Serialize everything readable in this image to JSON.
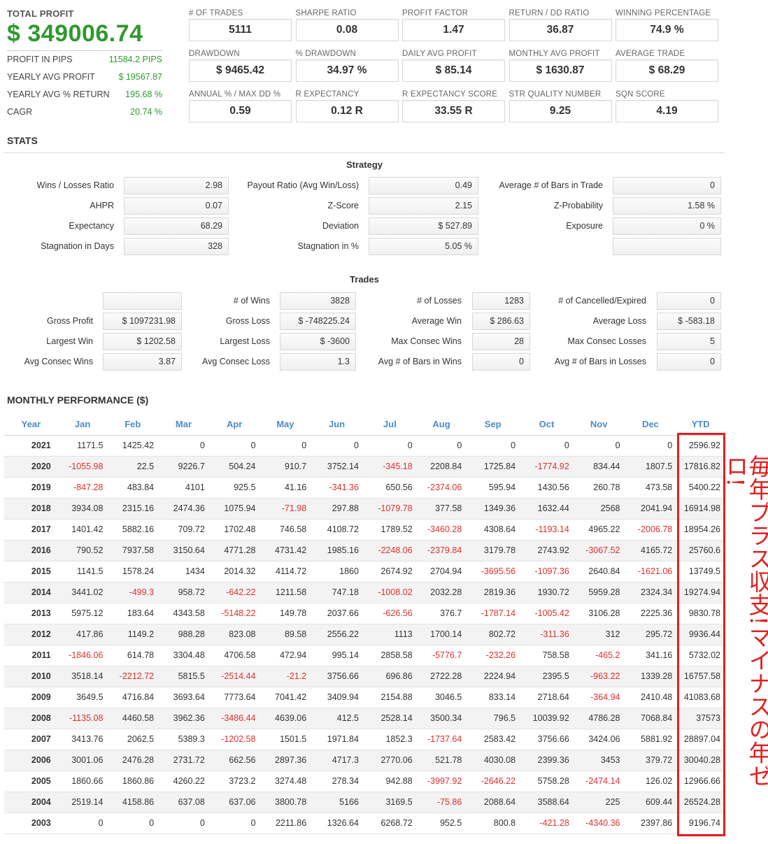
{
  "summary": {
    "total_label": "TOTAL PROFIT",
    "total_value": "$ 349006.74",
    "rows": [
      {
        "label": "PROFIT IN PIPS",
        "value": "11584.2 PIPS"
      },
      {
        "label": "YEARLY AVG PROFIT",
        "value": "$ 19567.87"
      },
      {
        "label": "YEARLY AVG % RETURN",
        "value": "195.68 %"
      },
      {
        "label": "CAGR",
        "value": "20.74 %"
      }
    ]
  },
  "metrics": [
    {
      "label": "# OF TRADES",
      "value": "5111"
    },
    {
      "label": "SHARPE RATIO",
      "value": "0.08"
    },
    {
      "label": "PROFIT FACTOR",
      "value": "1.47"
    },
    {
      "label": "RETURN / DD RATIO",
      "value": "36.87"
    },
    {
      "label": "WINNING PERCENTAGE",
      "value": "74.9 %"
    },
    {
      "label": "DRAWDOWN",
      "value": "$ 9465.42"
    },
    {
      "label": "% DRAWDOWN",
      "value": "34.97 %"
    },
    {
      "label": "DAILY AVG PROFIT",
      "value": "$ 85.14"
    },
    {
      "label": "MONTHLY AVG PROFIT",
      "value": "$ 1630.87"
    },
    {
      "label": "AVERAGE TRADE",
      "value": "$ 68.29"
    },
    {
      "label": "ANNUAL % / MAX DD %",
      "value": "0.59"
    },
    {
      "label": "R EXPECTANCY",
      "value": "0.12 R"
    },
    {
      "label": "R EXPECTANCY SCORE",
      "value": "33.55 R"
    },
    {
      "label": "STR QUALITY NUMBER",
      "value": "9.25"
    },
    {
      "label": "SQN SCORE",
      "value": "4.19"
    }
  ],
  "stats_title": "STATS",
  "strategy": {
    "title": "Strategy",
    "rows": [
      [
        {
          "label": "Wins / Losses Ratio",
          "value": "2.98"
        },
        {
          "label": "Payout Ratio (Avg Win/Loss)",
          "value": "0.49"
        },
        {
          "label": "Average # of Bars in Trade",
          "value": "0"
        }
      ],
      [
        {
          "label": "AHPR",
          "value": "0.07"
        },
        {
          "label": "Z-Score",
          "value": "2.15"
        },
        {
          "label": "Z-Probability",
          "value": "1.58 %"
        }
      ],
      [
        {
          "label": "Expectancy",
          "value": "68.29"
        },
        {
          "label": "Deviation",
          "value": "$ 527.89"
        },
        {
          "label": "Exposure",
          "value": "0 %"
        }
      ],
      [
        {
          "label": "Stagnation in Days",
          "value": "328"
        },
        {
          "label": "Stagnation in %",
          "value": "5.05 %"
        },
        {
          "label": "",
          "value": ""
        }
      ]
    ]
  },
  "trades": {
    "title": "Trades",
    "rows": [
      [
        {
          "label": "",
          "value": ""
        },
        {
          "label": "# of Wins",
          "value": "3828"
        },
        {
          "label": "# of Losses",
          "value": "1283"
        },
        {
          "label": "# of Cancelled/Expired",
          "value": "0"
        }
      ],
      [
        {
          "label": "Gross Profit",
          "value": "$ 1097231.98"
        },
        {
          "label": "Gross Loss",
          "value": "$ -748225.24"
        },
        {
          "label": "Average Win",
          "value": "$ 286.63"
        },
        {
          "label": "Average Loss",
          "value": "$ -583.18"
        }
      ],
      [
        {
          "label": "Largest Win",
          "value": "$ 1202.58"
        },
        {
          "label": "Largest Loss",
          "value": "$ -3600"
        },
        {
          "label": "Max Consec Wins",
          "value": "28"
        },
        {
          "label": "Max Consec Losses",
          "value": "5"
        }
      ],
      [
        {
          "label": "Avg Consec Wins",
          "value": "3.87"
        },
        {
          "label": "Avg Consec Loss",
          "value": "1.3"
        },
        {
          "label": "Avg # of Bars in Wins",
          "value": "0"
        },
        {
          "label": "Avg # of Bars in Losses",
          "value": "0"
        }
      ]
    ]
  },
  "monthly": {
    "title": "MONTHLY PERFORMANCE ($)",
    "headers": [
      "Year",
      "Jan",
      "Feb",
      "Mar",
      "Apr",
      "May",
      "Jun",
      "Jul",
      "Aug",
      "Sep",
      "Oct",
      "Nov",
      "Dec",
      "YTD"
    ],
    "rows": [
      [
        "2021",
        "1171.5",
        "1425.42",
        "0",
        "0",
        "0",
        "0",
        "0",
        "0",
        "0",
        "0",
        "0",
        "0",
        "2596.92"
      ],
      [
        "2020",
        "-1055.98",
        "22.5",
        "9226.7",
        "504.24",
        "910.7",
        "3752.14",
        "-345.18",
        "2208.84",
        "1725.84",
        "-1774.92",
        "834.44",
        "1807.5",
        "17816.82"
      ],
      [
        "2019",
        "-847.28",
        "483.84",
        "4101",
        "925.5",
        "41.16",
        "-341.36",
        "650.56",
        "-2374.06",
        "595.94",
        "1430.56",
        "260.78",
        "473.58",
        "5400.22"
      ],
      [
        "2018",
        "3934.08",
        "2315.16",
        "2474.36",
        "1075.94",
        "-71.98",
        "297.88",
        "-1079.78",
        "377.58",
        "1349.36",
        "1632.44",
        "2568",
        "2041.94",
        "16914.98"
      ],
      [
        "2017",
        "1401.42",
        "5882.16",
        "709.72",
        "1702.48",
        "746.58",
        "4108.72",
        "1789.52",
        "-3460.28",
        "4308.64",
        "-1193.14",
        "4965.22",
        "-2006.78",
        "18954.26"
      ],
      [
        "2016",
        "790.52",
        "7937.58",
        "3150.64",
        "4771.28",
        "4731.42",
        "1985.16",
        "-2248.06",
        "-2379.84",
        "3179.78",
        "2743.92",
        "-3067.52",
        "4165.72",
        "25760.6"
      ],
      [
        "2015",
        "1141.5",
        "1578.24",
        "1434",
        "2014.32",
        "4114.72",
        "1860",
        "2674.92",
        "2704.94",
        "-3695.56",
        "-1097.36",
        "2640.84",
        "-1621.06",
        "13749.5"
      ],
      [
        "2014",
        "3441.02",
        "-499.3",
        "958.72",
        "-642.22",
        "1211.58",
        "747.18",
        "-1008.02",
        "2032.28",
        "2819.36",
        "1930.72",
        "5959.28",
        "2324.34",
        "19274.94"
      ],
      [
        "2013",
        "5975.12",
        "183.64",
        "4343.58",
        "-5148.22",
        "149.78",
        "2037.66",
        "-626.56",
        "376.7",
        "-1787.14",
        "-1005.42",
        "3106.28",
        "2225.36",
        "9830.78"
      ],
      [
        "2012",
        "417.86",
        "1149.2",
        "988.28",
        "823.08",
        "89.58",
        "2556.22",
        "1113",
        "1700.14",
        "802.72",
        "-311.36",
        "312",
        "295.72",
        "9936.44"
      ],
      [
        "2011",
        "-1846.06",
        "614.78",
        "3304.48",
        "4706.58",
        "472.94",
        "995.14",
        "2858.58",
        "-5776.7",
        "-232.26",
        "758.58",
        "-465.2",
        "341.16",
        "5732.02"
      ],
      [
        "2010",
        "3518.14",
        "-2212.72",
        "5815.5",
        "-2514.44",
        "-21.2",
        "3756.66",
        "696.86",
        "2722.28",
        "2224.94",
        "2395.5",
        "-963.22",
        "1339.28",
        "16757.58"
      ],
      [
        "2009",
        "3649.5",
        "4716.84",
        "3693.64",
        "7773.64",
        "7041.42",
        "3409.94",
        "2154.88",
        "3046.5",
        "833.14",
        "2718.64",
        "-364.94",
        "2410.48",
        "41083.68"
      ],
      [
        "2008",
        "-1135.08",
        "4460.58",
        "3962.36",
        "-3486.44",
        "4639.06",
        "412.5",
        "2528.14",
        "3500.34",
        "796.5",
        "10039.92",
        "4786.28",
        "7068.84",
        "37573"
      ],
      [
        "2007",
        "3413.76",
        "2062.5",
        "5389.3",
        "-1202.58",
        "1501.5",
        "1971.84",
        "1852.3",
        "-1737.64",
        "2583.42",
        "3756.66",
        "3424.06",
        "5881.92",
        "28897.04"
      ],
      [
        "2006",
        "3001.06",
        "2476.28",
        "2731.72",
        "662.56",
        "2897.36",
        "4717.3",
        "2770.06",
        "521.78",
        "4030.08",
        "2399.36",
        "3453",
        "379.72",
        "30040.28"
      ],
      [
        "2005",
        "1860.66",
        "1860.86",
        "4260.22",
        "3723.2",
        "3274.48",
        "278.34",
        "942.88",
        "-3997.92",
        "-2646.22",
        "5758.28",
        "-2474.14",
        "126.02",
        "12966.66"
      ],
      [
        "2004",
        "2519.14",
        "4158.86",
        "637.08",
        "637.06",
        "3800.78",
        "5166",
        "3169.5",
        "-75.86",
        "2088.64",
        "3588.64",
        "225",
        "609.44",
        "26524.28"
      ],
      [
        "2003",
        "0",
        "0",
        "0",
        "0",
        "2211.86",
        "1326.64",
        "6268.72",
        "952.5",
        "800.8",
        "-421.28",
        "-4340.36",
        "2397.86",
        "9196.74"
      ]
    ]
  },
  "annotation": "毎年プラス収支!マイナスの年ゼロ!",
  "colors": {
    "profit_green": "#2e9a2e",
    "loss_red": "#e03030",
    "header_blue": "#4a8cc7",
    "highlight_red": "#e02020"
  }
}
